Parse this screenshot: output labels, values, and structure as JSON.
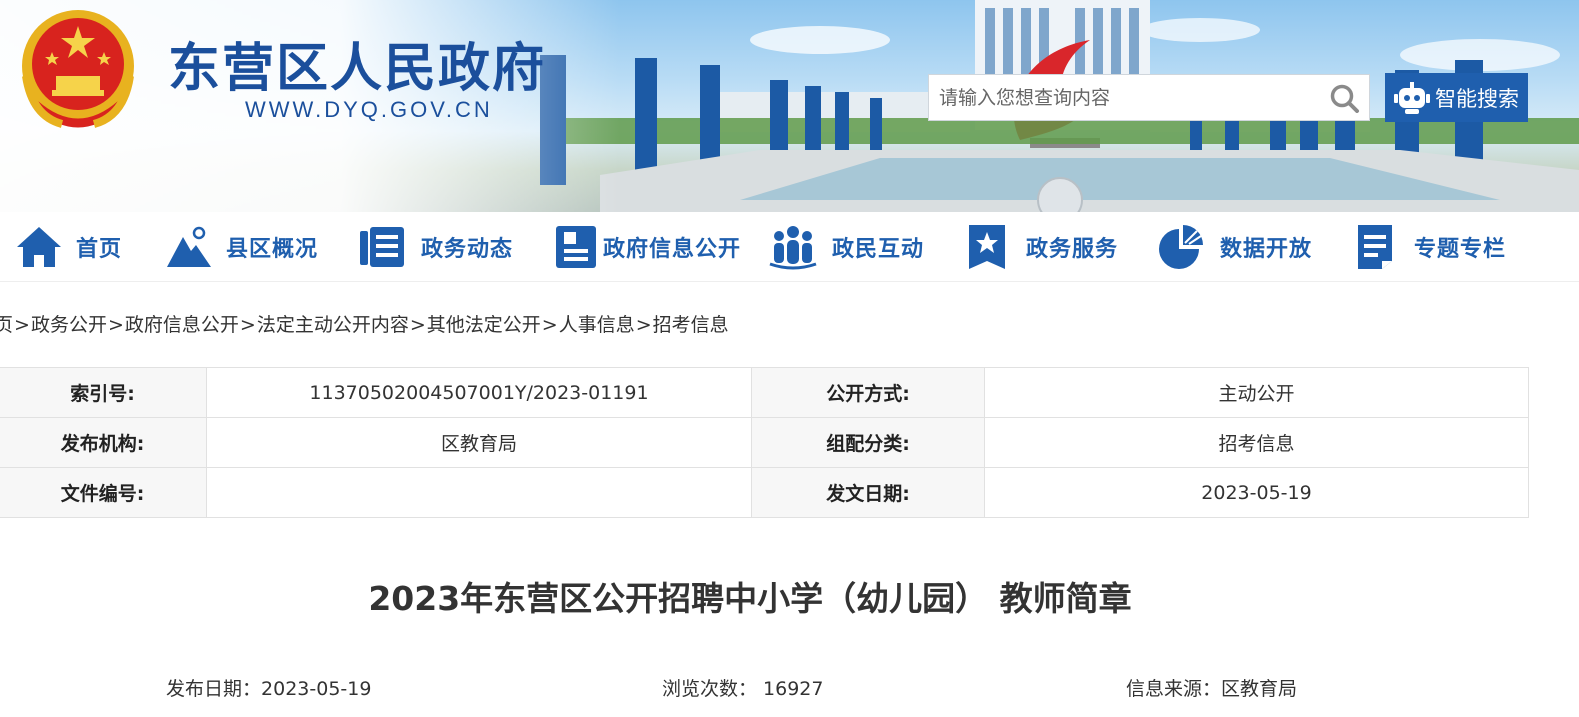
{
  "banner": {
    "site_title": "东营区人民政府",
    "site_url": "WWW.DYQ.GOV.CN",
    "search": {
      "placeholder": "请输入您想查询内容"
    },
    "smart_search_label": "智能搜索",
    "brand_color": "#1f5fae"
  },
  "nav": {
    "items": [
      {
        "label": "首页",
        "icon": "home-icon"
      },
      {
        "label": "县区概况",
        "icon": "mountain-icon"
      },
      {
        "label": "政务动态",
        "icon": "news-icon"
      },
      {
        "label": "政府信息公开",
        "icon": "document-icon"
      },
      {
        "label": "政民互动",
        "icon": "people-icon"
      },
      {
        "label": "政务服务",
        "icon": "star-badge-icon"
      },
      {
        "label": "数据开放",
        "icon": "pie-chart-icon"
      },
      {
        "label": "专题专栏",
        "icon": "notepad-icon"
      }
    ]
  },
  "breadcrumb": {
    "items": [
      "页",
      "政务公开",
      "政府信息公开",
      "法定主动公开内容",
      "其他法定公开",
      "人事信息",
      "招考信息"
    ],
    "separator": ">"
  },
  "info": {
    "index_label": "索引号:",
    "index_value": "11370502004507001Y/2023-01191",
    "public_mode_label": "公开方式:",
    "public_mode_value": "主动公开",
    "publisher_label": "发布机构:",
    "publisher_value": "区教育局",
    "category_label": "组配分类:",
    "category_value": "招考信息",
    "doc_no_label": "文件编号:",
    "doc_no_value": "",
    "issue_date_label": "发文日期:",
    "issue_date_value": "2023-05-19"
  },
  "article": {
    "title": "2023年东营区公开招聘中小学（幼儿园） 教师简章",
    "publish_date_label": "发布日期：",
    "publish_date": "2023-05-19",
    "views_label": "浏览次数：",
    "views": "16927",
    "source_label": "信息来源：",
    "source": "区教育局"
  }
}
